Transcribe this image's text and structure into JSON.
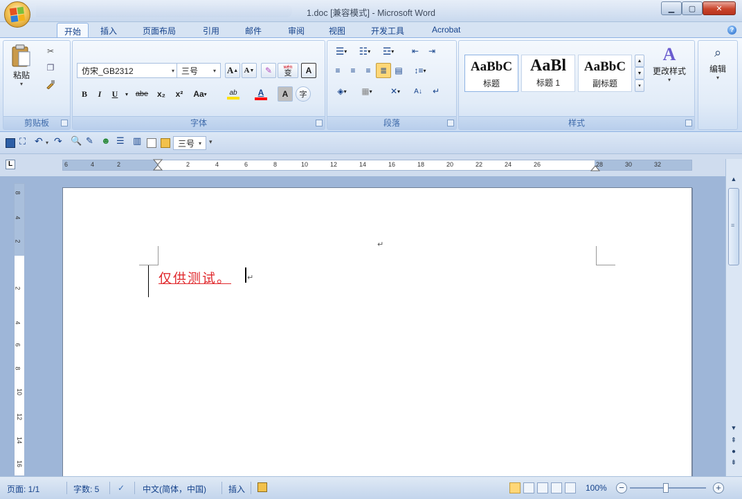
{
  "window": {
    "title": "1.doc [兼容模式] - Microsoft Word"
  },
  "ribbon_tabs": [
    "开始",
    "插入",
    "页面布局",
    "引用",
    "邮件",
    "审阅",
    "视图",
    "开发工具",
    "Acrobat"
  ],
  "clipboard": {
    "paste_label": "粘贴",
    "group_label": "剪贴板"
  },
  "font": {
    "font_name": "仿宋_GB2312",
    "font_size": "三号",
    "grow_label": "A",
    "shrink_label": "A",
    "phonetic_label": "wén",
    "phonetic_char": "变",
    "border_label": "A",
    "bold_label": "B",
    "italic_label": "I",
    "underline_label": "U",
    "strike_label": "abe",
    "sub_label": "x₂",
    "sup_label": "x²",
    "case_label": "Aa",
    "highlight_label": "ab",
    "color_label": "A",
    "shade_label": "A",
    "enclose_label": "字",
    "group_label": "字体"
  },
  "paragraph": {
    "group_label": "段落"
  },
  "styles": {
    "items": [
      {
        "sample": "AaBbC",
        "name": "标题"
      },
      {
        "sample": "AaBl",
        "name": "标题 1"
      },
      {
        "sample": "AaBbC",
        "name": "副标题"
      }
    ],
    "change_label": "更改样式",
    "group_label": "样式"
  },
  "editing": {
    "label": "编辑"
  },
  "qat": {
    "font_size": "三号"
  },
  "ruler": {
    "tab_selector": "L",
    "h_numbers": [
      "6",
      "4",
      "2",
      "2",
      "4",
      "6",
      "8",
      "10",
      "12",
      "14",
      "16",
      "18",
      "20",
      "22",
      "24",
      "26",
      "28",
      "30",
      "32"
    ],
    "v_numbers": [
      "8",
      "4",
      "2",
      "2",
      "4",
      "6",
      "8",
      "10",
      "12",
      "14",
      "16"
    ]
  },
  "document": {
    "text": "仅供测试。",
    "para_mark": "↵"
  },
  "statusbar": {
    "page": "页面: 1/1",
    "words": "字数: 5",
    "language": "中文(简体，中国)",
    "mode": "插入",
    "zoom": "100%",
    "zoom_out": "−",
    "zoom_in": "+"
  },
  "colors": {
    "text_red": "#e0282c",
    "ribbon_blue": "#15428b",
    "highlight_yellow": "#ffe000",
    "font_color_red": "#ff0000"
  }
}
